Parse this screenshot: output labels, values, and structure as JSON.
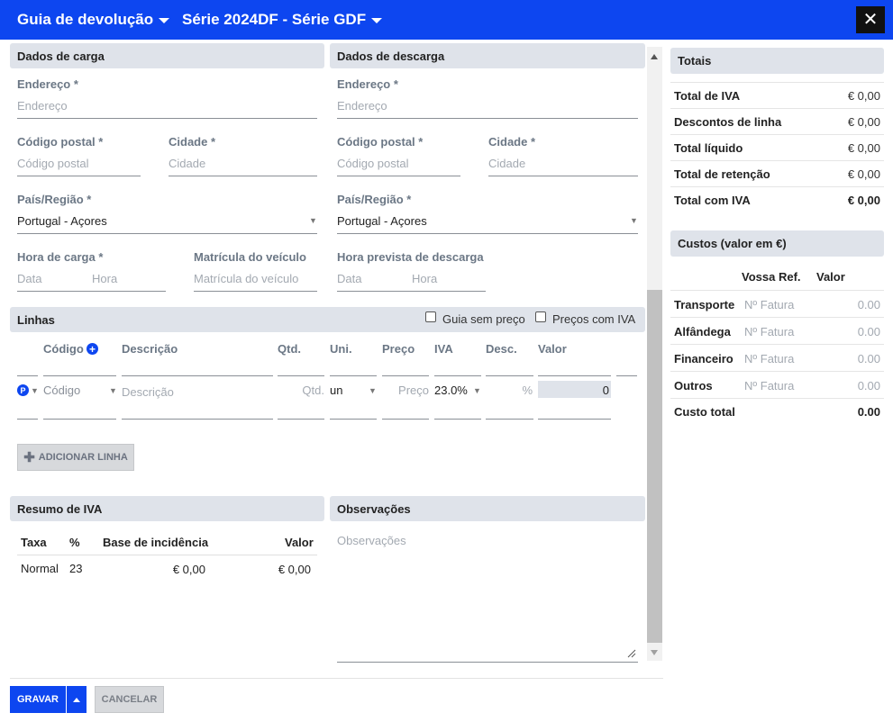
{
  "header": {
    "title": "Guia de devolução",
    "series": "Série  2024DF - Série GDF",
    "close_glyph": "✕"
  },
  "carga": {
    "title": "Dados de carga",
    "address_label": "Endereço *",
    "address_placeholder": "Endereço",
    "postal_label": "Código postal *",
    "postal_placeholder": "Código postal",
    "city_label": "Cidade *",
    "city_placeholder": "Cidade",
    "country_label": "País/Região *",
    "country_value": "Portugal - Açores",
    "time_label": "Hora de carga *",
    "date_placeholder": "Data",
    "hour_placeholder": "Hora",
    "plate_label": "Matrícula do veículo",
    "plate_placeholder": "Matrícula do veículo"
  },
  "descarga": {
    "title": "Dados de descarga",
    "address_label": "Endereço *",
    "address_placeholder": "Endereço",
    "postal_label": "Código postal *",
    "postal_placeholder": "Código postal",
    "city_label": "Cidade *",
    "city_placeholder": "Cidade",
    "country_label": "País/Região *",
    "country_value": "Portugal - Açores",
    "time_label": "Hora prevista de descarga",
    "date_placeholder": "Data",
    "hour_placeholder": "Hora"
  },
  "linhas": {
    "title": "Linhas",
    "guia_sem_preco": "Guia sem preço",
    "precos_com_iva": "Preços com IVA",
    "columns": {
      "codigo": "Código",
      "descricao": "Descrição",
      "qtd": "Qtd.",
      "uni": "Uni.",
      "preco": "Preço",
      "iva": "IVA",
      "desc": "Desc.",
      "valor": "Valor"
    },
    "row": {
      "badge": "P",
      "codigo_placeholder": "Código",
      "descricao_placeholder": "Descrição",
      "qtd_placeholder": "Qtd.",
      "uni_value": "un",
      "preco_placeholder": "Preço",
      "iva_value": "23.0%",
      "desc_placeholder": "%",
      "valor_value": "0"
    },
    "add_button": "ADICIONAR LINHA"
  },
  "resumo_iva": {
    "title": "Resumo de IVA",
    "columns": [
      "Taxa",
      "%",
      "Base de incidência",
      "Valor"
    ],
    "rows": [
      {
        "taxa": "Normal",
        "pct": "23",
        "base": "€ 0,00",
        "valor": "€ 0,00"
      }
    ]
  },
  "observacoes": {
    "title": "Observações",
    "placeholder": "Observações"
  },
  "totais": {
    "title": "Totais",
    "rows": [
      {
        "label": "Total de IVA",
        "value": "€ 0,00"
      },
      {
        "label": "Descontos de linha",
        "value": "€ 0,00"
      },
      {
        "label": "Total líquido",
        "value": "€ 0,00"
      },
      {
        "label": "Total de retenção",
        "value": "€ 0,00"
      },
      {
        "label": "Total com IVA",
        "value": "€ 0,00"
      }
    ]
  },
  "custos": {
    "title": "Custos (valor em €)",
    "col_ref": "Vossa Ref.",
    "col_valor": "Valor",
    "rows": [
      {
        "label": "Transporte",
        "ref_placeholder": "Nº Fatura",
        "value": "0.00"
      },
      {
        "label": "Alfândega",
        "ref_placeholder": "Nº Fatura",
        "value": "0.00"
      },
      {
        "label": "Financeiro",
        "ref_placeholder": "Nº Fatura",
        "value": "0.00"
      },
      {
        "label": "Outros",
        "ref_placeholder": "Nº Fatura",
        "value": "0.00"
      }
    ],
    "total_label": "Custo total",
    "total_value": "0.00"
  },
  "footer": {
    "save": "GRAVAR",
    "cancel": "CANCELAR"
  },
  "colors": {
    "accent": "#0d46f0",
    "section_bg": "#dfe3ea"
  }
}
